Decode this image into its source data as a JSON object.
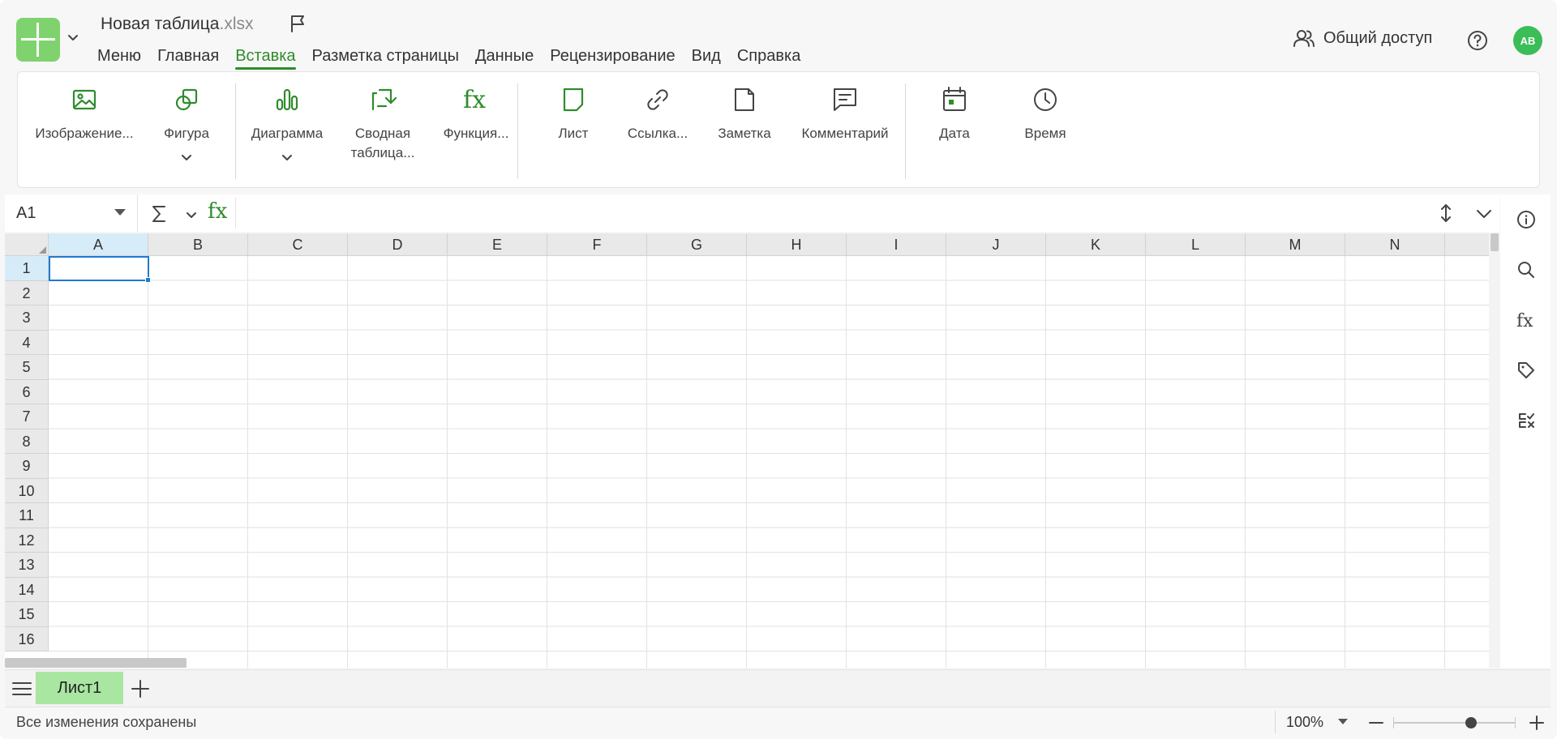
{
  "app": {
    "title_name": "Новая таблица",
    "title_ext": ".xlsx",
    "menu": [
      "Меню",
      "Главная",
      "Вставка",
      "Разметка страницы",
      "Данные",
      "Рецензирование",
      "Вид",
      "Справка"
    ],
    "active_menu": "Вставка",
    "share_label": "Общий доступ",
    "avatar_initials": "AB",
    "accent_color": "#2f8c2c",
    "logo_color": "#7ed36e"
  },
  "ribbon": {
    "image": "Изображение...",
    "shape": "Фигура",
    "chart": "Диаграмма",
    "pivot_line1": "Сводная",
    "pivot_line2": "таблица...",
    "function": "Функция...",
    "sheet": "Лист",
    "link": "Ссылка...",
    "note": "Заметка",
    "comment": "Комментарий",
    "date": "Дата",
    "time": "Время"
  },
  "formula_bar": {
    "name_box": "A1",
    "fx_label": "fx",
    "formula": ""
  },
  "grid": {
    "columns": [
      "A",
      "B",
      "C",
      "D",
      "E",
      "F",
      "G",
      "H",
      "I",
      "J",
      "K",
      "L",
      "M",
      "N"
    ],
    "rows": [
      "1",
      "2",
      "3",
      "4",
      "5",
      "6",
      "7",
      "8",
      "9",
      "10",
      "11",
      "12",
      "13",
      "14",
      "15",
      "16"
    ],
    "selected_cell": "A1"
  },
  "sheets": {
    "tabs": [
      "Лист1"
    ],
    "active": "Лист1"
  },
  "status": {
    "message": "Все изменения сохранены",
    "zoom": "100%",
    "zoom_level_percent": 100
  }
}
